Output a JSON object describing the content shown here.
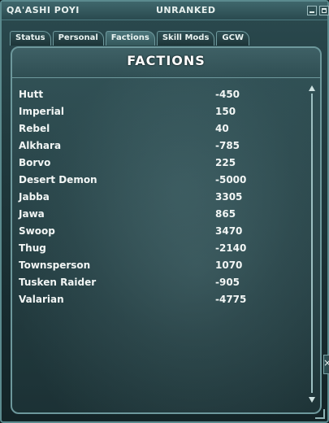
{
  "window": {
    "character_name": "QA'ASHI POYI",
    "rank_status": "UNRANKED"
  },
  "tabs": [
    {
      "label": "Status",
      "active": false
    },
    {
      "label": "Personal",
      "active": false
    },
    {
      "label": "Factions",
      "active": true
    },
    {
      "label": "Skill Mods",
      "active": false
    },
    {
      "label": "GCW",
      "active": false
    }
  ],
  "panel": {
    "title": "FACTIONS"
  },
  "factions": [
    {
      "name": "Hutt",
      "value": "-450"
    },
    {
      "name": "Imperial",
      "value": "150"
    },
    {
      "name": "Rebel",
      "value": "40"
    },
    {
      "name": "Alkhara",
      "value": "-785"
    },
    {
      "name": "Borvo",
      "value": "225"
    },
    {
      "name": "Desert Demon",
      "value": "-5000"
    },
    {
      "name": "Jabba",
      "value": "3305"
    },
    {
      "name": "Jawa",
      "value": "865"
    },
    {
      "name": "Swoop",
      "value": "3470"
    },
    {
      "name": "Thug",
      "value": "-2140"
    },
    {
      "name": "Townsperson",
      "value": "1070"
    },
    {
      "name": "Tusken Raider",
      "value": "-905"
    },
    {
      "name": "Valarian",
      "value": "-4775"
    }
  ],
  "icons": {
    "minimize": "minimize-icon",
    "maximize": "maximize-icon",
    "close": "close-icon",
    "scroll_up": "arrow-up-icon",
    "scroll_down": "arrow-down-icon"
  }
}
